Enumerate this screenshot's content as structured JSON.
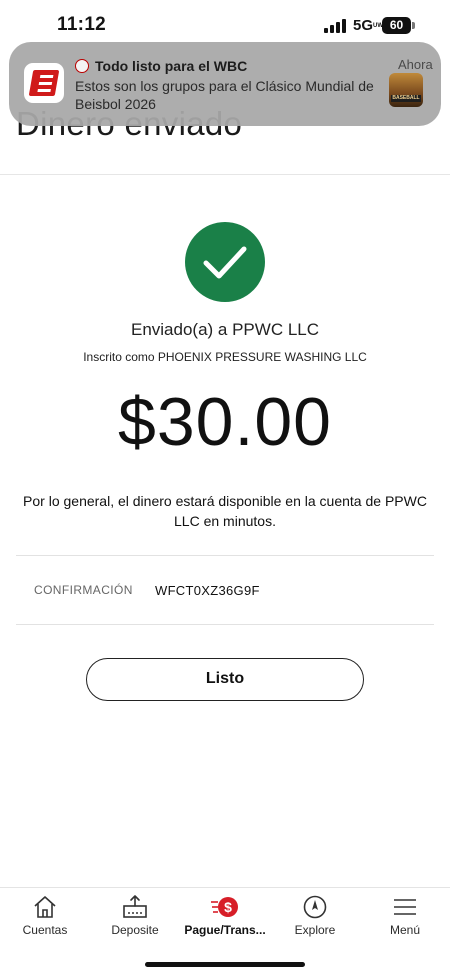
{
  "status_bar": {
    "time": "11:12",
    "network": "5G",
    "network_suffix": "UW",
    "battery": "60"
  },
  "page": {
    "title": "Dinero enviado"
  },
  "notification": {
    "title": "Todo listo para el WBC",
    "body": "Estos son los grupos para el Clásico Mundial de Beisbol 2026",
    "time": "Ahora",
    "thumbnail_text": "BASEBALL",
    "app_icon": "espn-icon"
  },
  "confirmation": {
    "sent_to": "Enviado(a) a PPWC LLC",
    "registered_as": "Inscrito como PHOENIX PRESSURE WASHING LLC",
    "amount": "$30.00",
    "availability": "Por lo general, el dinero estará disponible en la cuenta de PPWC LLC en minutos.",
    "code_label": "CONFIRMACIÓN",
    "code_value": "WFCT0XZ36G9F",
    "done_label": "Listo",
    "success_color": "#1a8048"
  },
  "tab_bar": {
    "accent": "#d71e28",
    "items": [
      {
        "label": "Cuentas",
        "icon": "home-icon"
      },
      {
        "label": "Deposite",
        "icon": "deposit-icon"
      },
      {
        "label": "Pague/Trans...",
        "icon": "pay-transfer-icon",
        "active": true
      },
      {
        "label": "Explore",
        "icon": "compass-icon"
      },
      {
        "label": "Menú",
        "icon": "menu-icon"
      }
    ]
  }
}
